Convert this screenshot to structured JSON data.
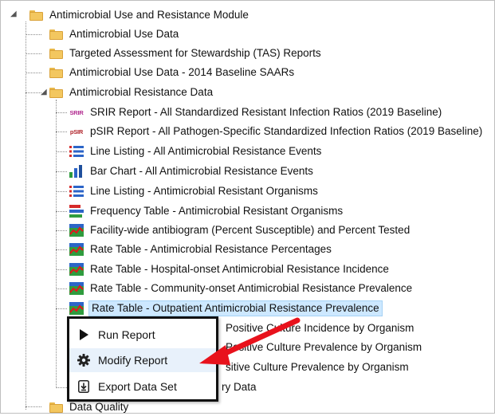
{
  "tree": {
    "module": {
      "label": "Antimicrobial Use and Resistance Module"
    },
    "folders": [
      {
        "label": "Antimicrobial Use Data"
      },
      {
        "label": "Targeted Assessment for Stewardship (TAS) Reports"
      },
      {
        "label": "Antimicrobial Use Data - 2014 Baseline SAARs"
      },
      {
        "label": "Antimicrobial Resistance Data"
      }
    ],
    "reports": [
      {
        "label": "SRIR Report - All Standardized Resistant Infection Ratios (2019 Baseline)",
        "icon_text": "SRIR"
      },
      {
        "label": "pSIR Report - All Pathogen-Specific Standardized Infection Ratios (2019 Baseline)",
        "icon_text": "pSIR"
      },
      {
        "label": "Line Listing - All Antimicrobial Resistance Events"
      },
      {
        "label": "Bar Chart - All Antimicrobial Resistance Events"
      },
      {
        "label": "Line Listing - Antimicrobial Resistant Organisms"
      },
      {
        "label": "Frequency Table - Antimicrobial Resistant Organisms"
      },
      {
        "label": "Facility-wide antibiogram (Percent Susceptible) and Percent Tested"
      },
      {
        "label": "Rate Table - Antimicrobial Resistance Percentages"
      },
      {
        "label": "Rate Table - Hospital-onset Antimicrobial Resistance Incidence"
      },
      {
        "label": "Rate Table - Community-onset Antimicrobial Resistance Prevalence"
      },
      {
        "label": "Rate Table - Outpatient Antimicrobial Resistance Prevalence"
      },
      {
        "label": "Positive Culture Incidence by Organism"
      },
      {
        "label": "Positive Culture Prevalence by Organism"
      },
      {
        "label": "sitive Culture Prevalence by Organism"
      },
      {
        "label": "ry Data"
      }
    ],
    "bottom_folder": {
      "label": "Data Quality"
    }
  },
  "context_menu": {
    "items": [
      {
        "label": "Run Report",
        "icon": "play-icon"
      },
      {
        "label": "Modify Report",
        "icon": "gear-icon"
      },
      {
        "label": "Export Data Set",
        "icon": "export-icon"
      }
    ]
  },
  "colors": {
    "selection": "#cde8ff",
    "arrow": "#e8121c",
    "folder": "#f3c75f"
  }
}
